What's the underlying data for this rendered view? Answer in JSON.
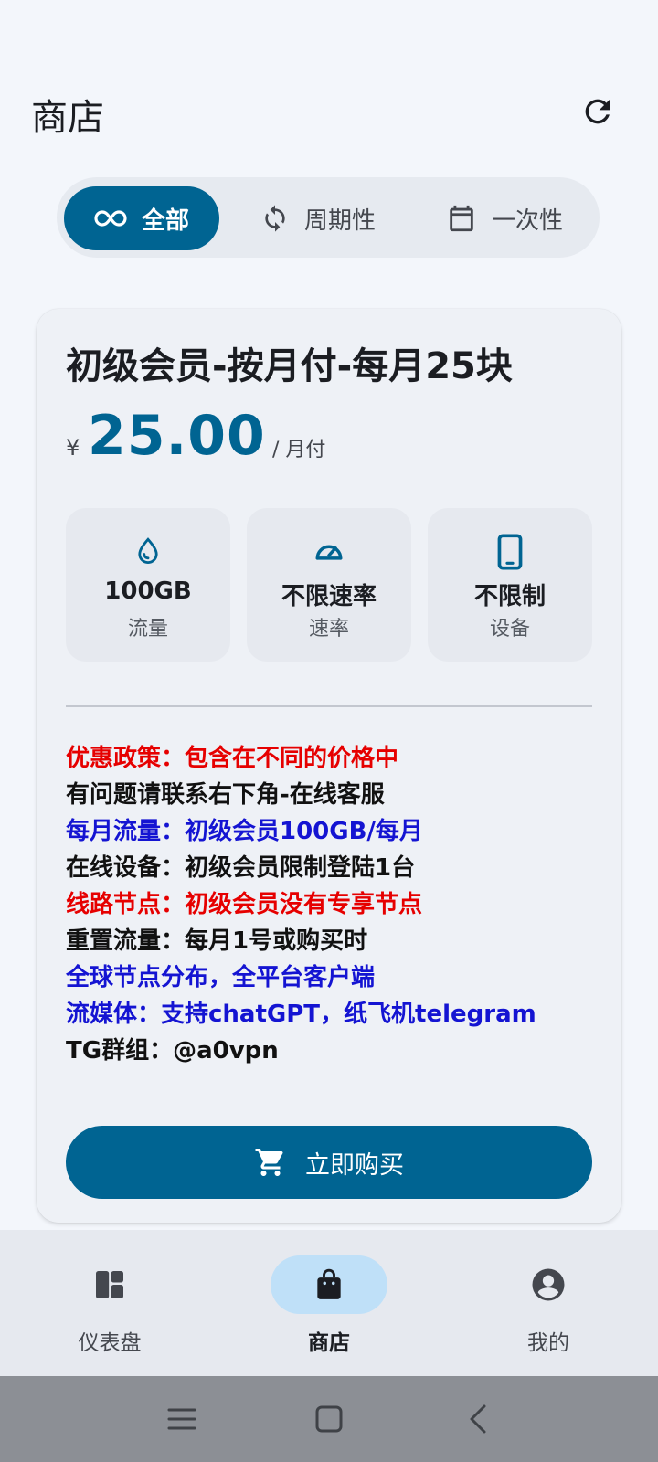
{
  "header": {
    "title": "商店"
  },
  "filter_tabs": [
    {
      "label": "全部",
      "icon": "infinity-icon",
      "active": true
    },
    {
      "label": "周期性",
      "icon": "sync-icon",
      "active": false
    },
    {
      "label": "一次性",
      "icon": "calendar-icon",
      "active": false
    }
  ],
  "plan": {
    "title": "初级会员-按月付-每月25块",
    "currency": "¥",
    "price": "25.00",
    "period": "/ 月付",
    "features": [
      {
        "icon": "water-drop-icon",
        "value": "100GB",
        "label": "流量"
      },
      {
        "icon": "speedometer-icon",
        "value": "不限速率",
        "label": "速率"
      },
      {
        "icon": "phone-icon",
        "value": "不限制",
        "label": "设备"
      }
    ],
    "description": [
      {
        "text": "优惠政策：包含在不同的价格中",
        "color": "#e60000"
      },
      {
        "text": "有问题请联系右下角-在线客服",
        "color": "#111111"
      },
      {
        "text": "每月流量：初级会员100GB/每月",
        "color": "#1414d2"
      },
      {
        "text": "在线设备：初级会员限制登陆1台",
        "color": "#111111"
      },
      {
        "text": "线路节点：初级会员没有专享节点",
        "color": "#e60000"
      },
      {
        "text": "重置流量：每月1号或购买时",
        "color": "#111111"
      },
      {
        "text": "全球节点分布，全平台客户端",
        "color": "#1414d2"
      },
      {
        "text": "流媒体：支持chatGPT，纸飞机telegram",
        "color": "#1414d2"
      },
      {
        "text": "TG群组：@a0vpn",
        "color": "#111111"
      }
    ],
    "buy_label": "立即购买"
  },
  "bottom_nav": [
    {
      "label": "仪表盘",
      "icon": "dashboard-icon",
      "active": false
    },
    {
      "label": "商店",
      "icon": "shopping-bag-icon",
      "active": true
    },
    {
      "label": "我的",
      "icon": "account-circle-icon",
      "active": false
    }
  ],
  "colors": {
    "primary": "#006492",
    "nav_active": "#bfe0f8",
    "background": "#f3f6fb"
  }
}
